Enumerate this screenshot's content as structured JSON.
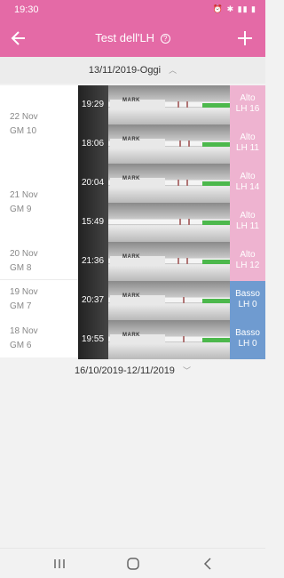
{
  "status": {
    "time": "19:30",
    "icons": "⏰ ✱ ▮▮ ▮"
  },
  "appbar": {
    "title": "Test dell'LH",
    "help": "?"
  },
  "range_current": "13/11/2019-Oggi",
  "range_previous": "16/10/2019-12/11/2019",
  "days": [
    {
      "date": "22 Nov",
      "cycle": "GM 10"
    },
    {
      "date": "21 Nov",
      "cycle": "GM 9"
    },
    {
      "date": "20 Nov",
      "cycle": "GM 8"
    },
    {
      "date": "19 Nov",
      "cycle": "GM 7"
    },
    {
      "date": "18 Nov",
      "cycle": "GM 6"
    }
  ],
  "tests": [
    {
      "time": "19:29",
      "level": "Alto",
      "lh": "LH 16",
      "brand": "MARK"
    },
    {
      "time": "18:06",
      "level": "Alto",
      "lh": "LH 11",
      "brand": "MARK"
    },
    {
      "time": "20:04",
      "level": "Alto",
      "lh": "LH 14",
      "brand": "MARK"
    },
    {
      "time": "15:49",
      "level": "Alto",
      "lh": "LH 11",
      "brand": ""
    },
    {
      "time": "21:36",
      "level": "Alto",
      "lh": "LH 12",
      "brand": "MARK"
    },
    {
      "time": "20:37",
      "level": "Basso",
      "lh": "LH 0",
      "brand": "MARK"
    },
    {
      "time": "19:55",
      "level": "Basso",
      "lh": "LH 0",
      "brand": "MARK"
    }
  ]
}
